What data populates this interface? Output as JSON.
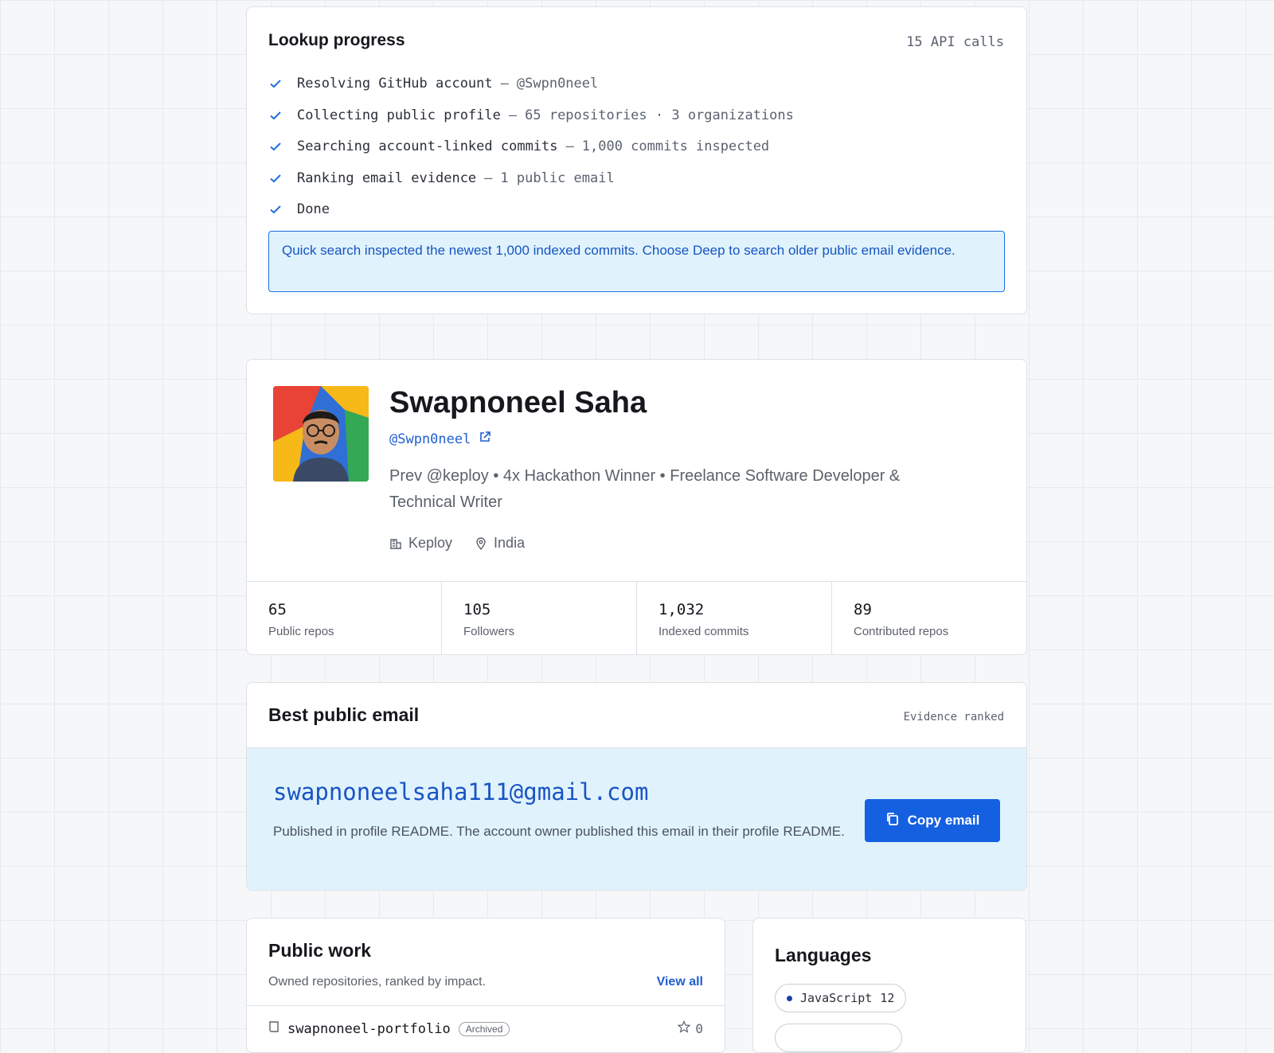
{
  "progress": {
    "title": "Lookup progress",
    "api_calls": "15 API calls",
    "steps": [
      {
        "label": "Resolving GitHub account",
        "detail": "@Swpn0neel"
      },
      {
        "label": "Collecting public profile",
        "detail": "65 repositories · 3 organizations"
      },
      {
        "label": "Searching account-linked commits",
        "detail": "1,000 commits inspected"
      },
      {
        "label": "Ranking email evidence",
        "detail": "1 public email"
      },
      {
        "label": "Done",
        "detail": ""
      }
    ],
    "separator": "—",
    "note": "Quick search inspected the newest 1,000 indexed commits. Choose Deep to search older public email evidence."
  },
  "profile": {
    "name": "Swapnoneel Saha",
    "handle": "@Swpn0neel",
    "bio": "Prev @keploy • 4x Hackathon Winner • Freelance Software Developer & Technical Writer",
    "company": "Keploy",
    "location": "India",
    "stats": [
      {
        "value": "65",
        "label": "Public repos"
      },
      {
        "value": "105",
        "label": "Followers"
      },
      {
        "value": "1,032",
        "label": "Indexed commits"
      },
      {
        "value": "89",
        "label": "Contributed repos"
      }
    ]
  },
  "email": {
    "title": "Best public email",
    "tag": "Evidence ranked",
    "address": "swapnoneelsaha111@gmail.com",
    "description": "Published in profile README. The account owner published this email in their profile README.",
    "copy_label": "Copy email"
  },
  "work": {
    "title": "Public work",
    "subtitle": "Owned repositories, ranked by impact.",
    "view_all": "View all",
    "repo_name": "swapnoneel-portfolio",
    "repo_badge": "Archived",
    "repo_stars": "0"
  },
  "languages": {
    "title": "Languages",
    "items": [
      {
        "name": "JavaScript",
        "count": "12"
      }
    ]
  },
  "colors": {
    "accent": "#1560e0",
    "note_bg": "#e0f3fd",
    "check": "#1f6fe0"
  }
}
